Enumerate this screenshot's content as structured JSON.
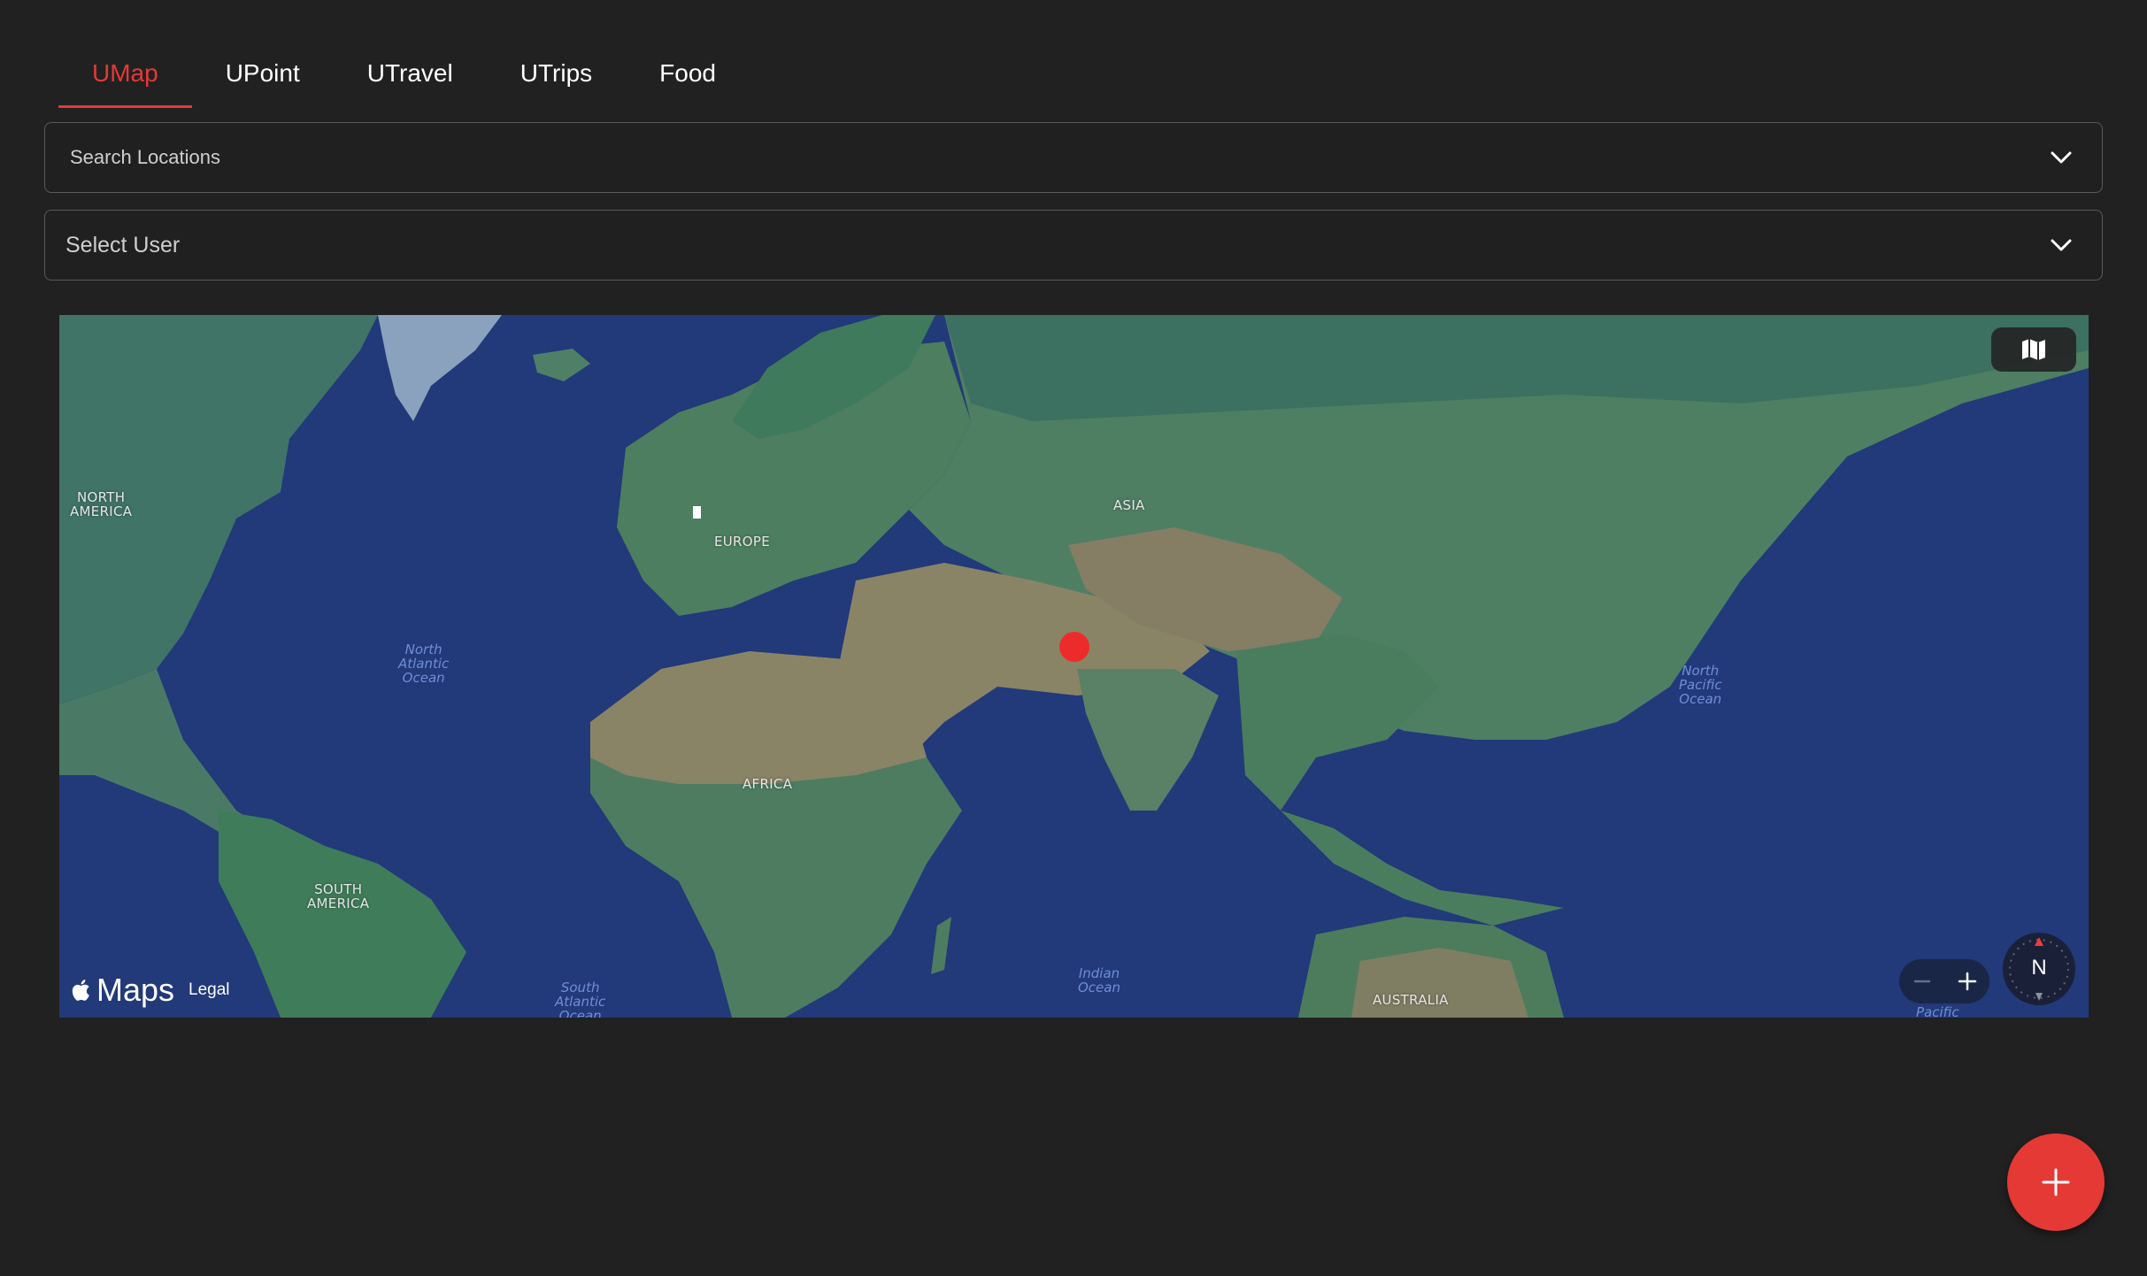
{
  "tabs": [
    {
      "label": "UMap",
      "active": true
    },
    {
      "label": "UPoint",
      "active": false
    },
    {
      "label": "UTravel",
      "active": false
    },
    {
      "label": "UTrips",
      "active": false
    },
    {
      "label": "Food",
      "active": false
    }
  ],
  "search": {
    "placeholder": "Search Locations"
  },
  "user_select": {
    "placeholder": "Select User"
  },
  "map": {
    "continents": {
      "north_america": "NORTH\nAMERICA",
      "europe": "EUROPE",
      "asia": "ASIA",
      "africa": "AFRICA",
      "south_america": "SOUTH\nAMERICA",
      "australia": "AUSTRALIA"
    },
    "oceans": {
      "north_atlantic": "North\nAtlantic\nOcean",
      "north_pacific": "North\nPacific\nOcean",
      "indian": "Indian\nOcean",
      "south_atlantic": "South\nAtlantic\nOcean",
      "pacific_partial": "Pacific"
    },
    "brand": "Maps",
    "legal": "Legal",
    "compass_label": "N",
    "zoom_out": "−",
    "zoom_in": "+"
  },
  "fab": {
    "icon": "plus-icon"
  },
  "colors": {
    "accent": "#e53935",
    "background": "#212121",
    "ocean": "#22397a",
    "land": "#4a7a66",
    "desert": "#8a8466"
  }
}
